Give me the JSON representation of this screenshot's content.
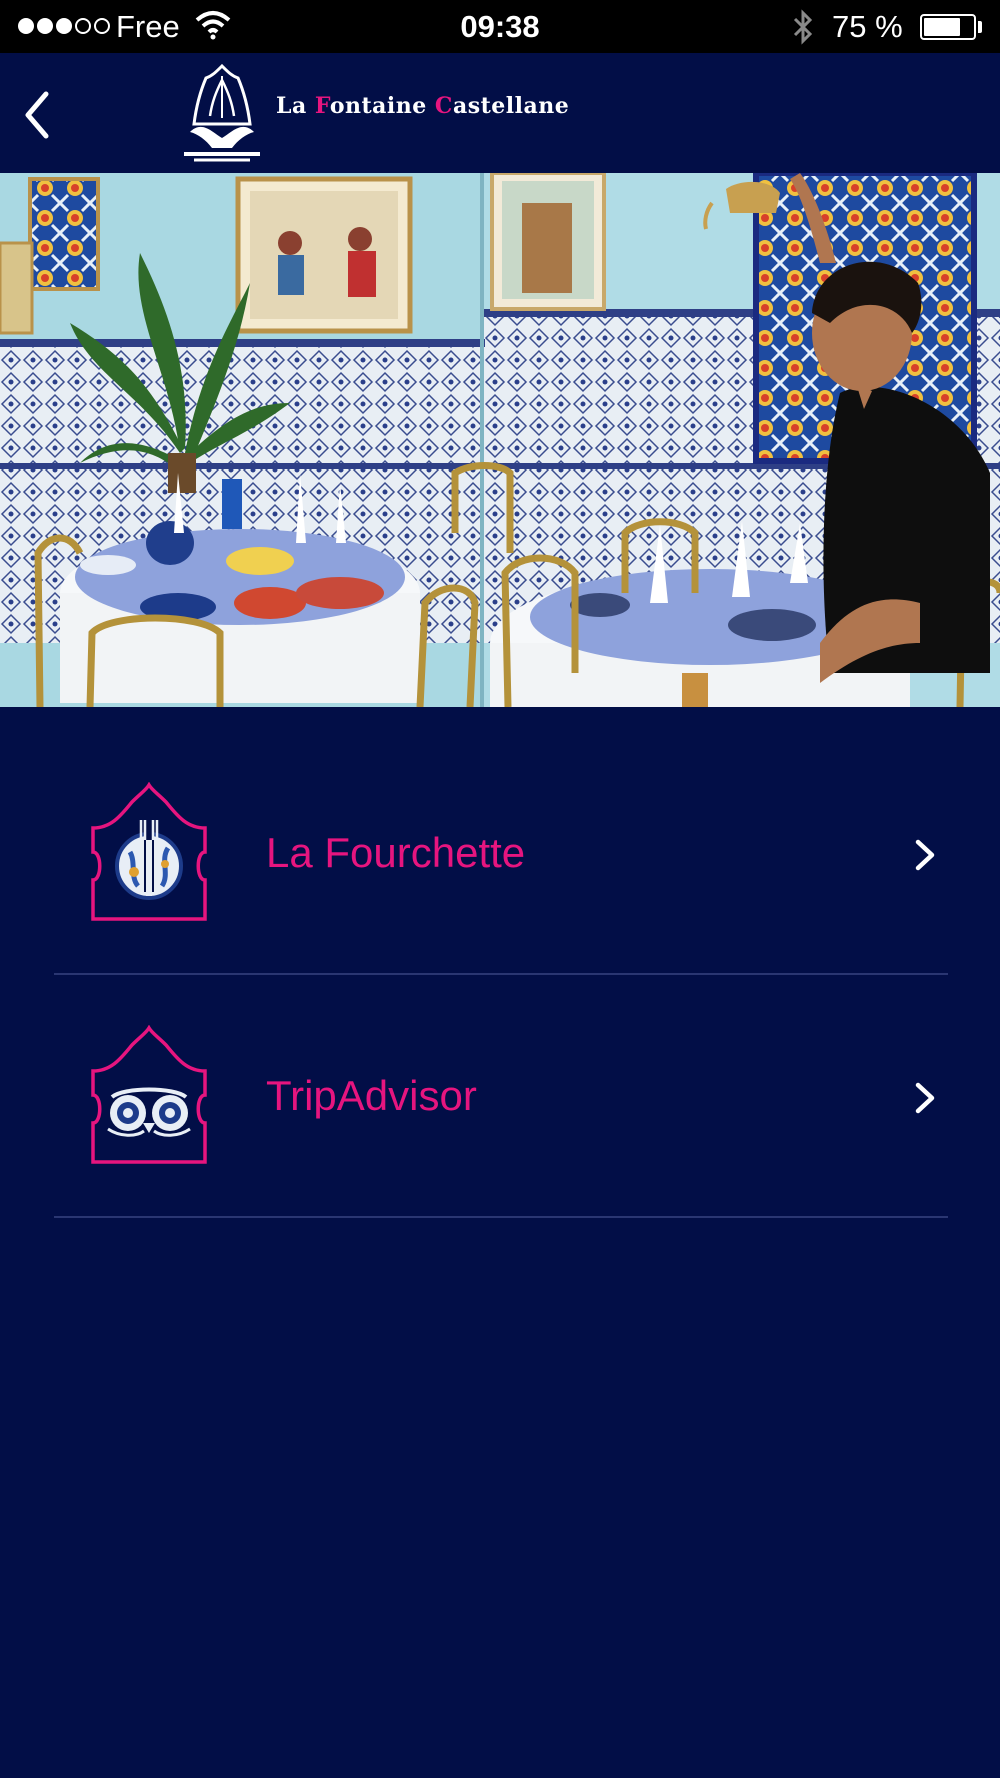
{
  "status_bar": {
    "carrier": "Free",
    "time": "09:38",
    "battery_text": "75 %",
    "battery_level": 0.75,
    "signal_bars_filled": 3,
    "signal_bars_total": 5
  },
  "header": {
    "brand_parts": [
      {
        "text": "La ",
        "highlight": false
      },
      {
        "text": "F",
        "highlight": true
      },
      {
        "text": "ontaine ",
        "highlight": false
      },
      {
        "text": "C",
        "highlight": true
      },
      {
        "text": "astellane",
        "highlight": false
      }
    ],
    "back_icon": "chevron-left-icon"
  },
  "menu": {
    "items": [
      {
        "label": "La Fourchette",
        "icon": "fork-plate-icon"
      },
      {
        "label": "TripAdvisor",
        "icon": "owl-eyes-icon"
      }
    ]
  },
  "colors": {
    "background": "#020e47",
    "accent": "#e6157f",
    "divider": "#2a3672"
  }
}
